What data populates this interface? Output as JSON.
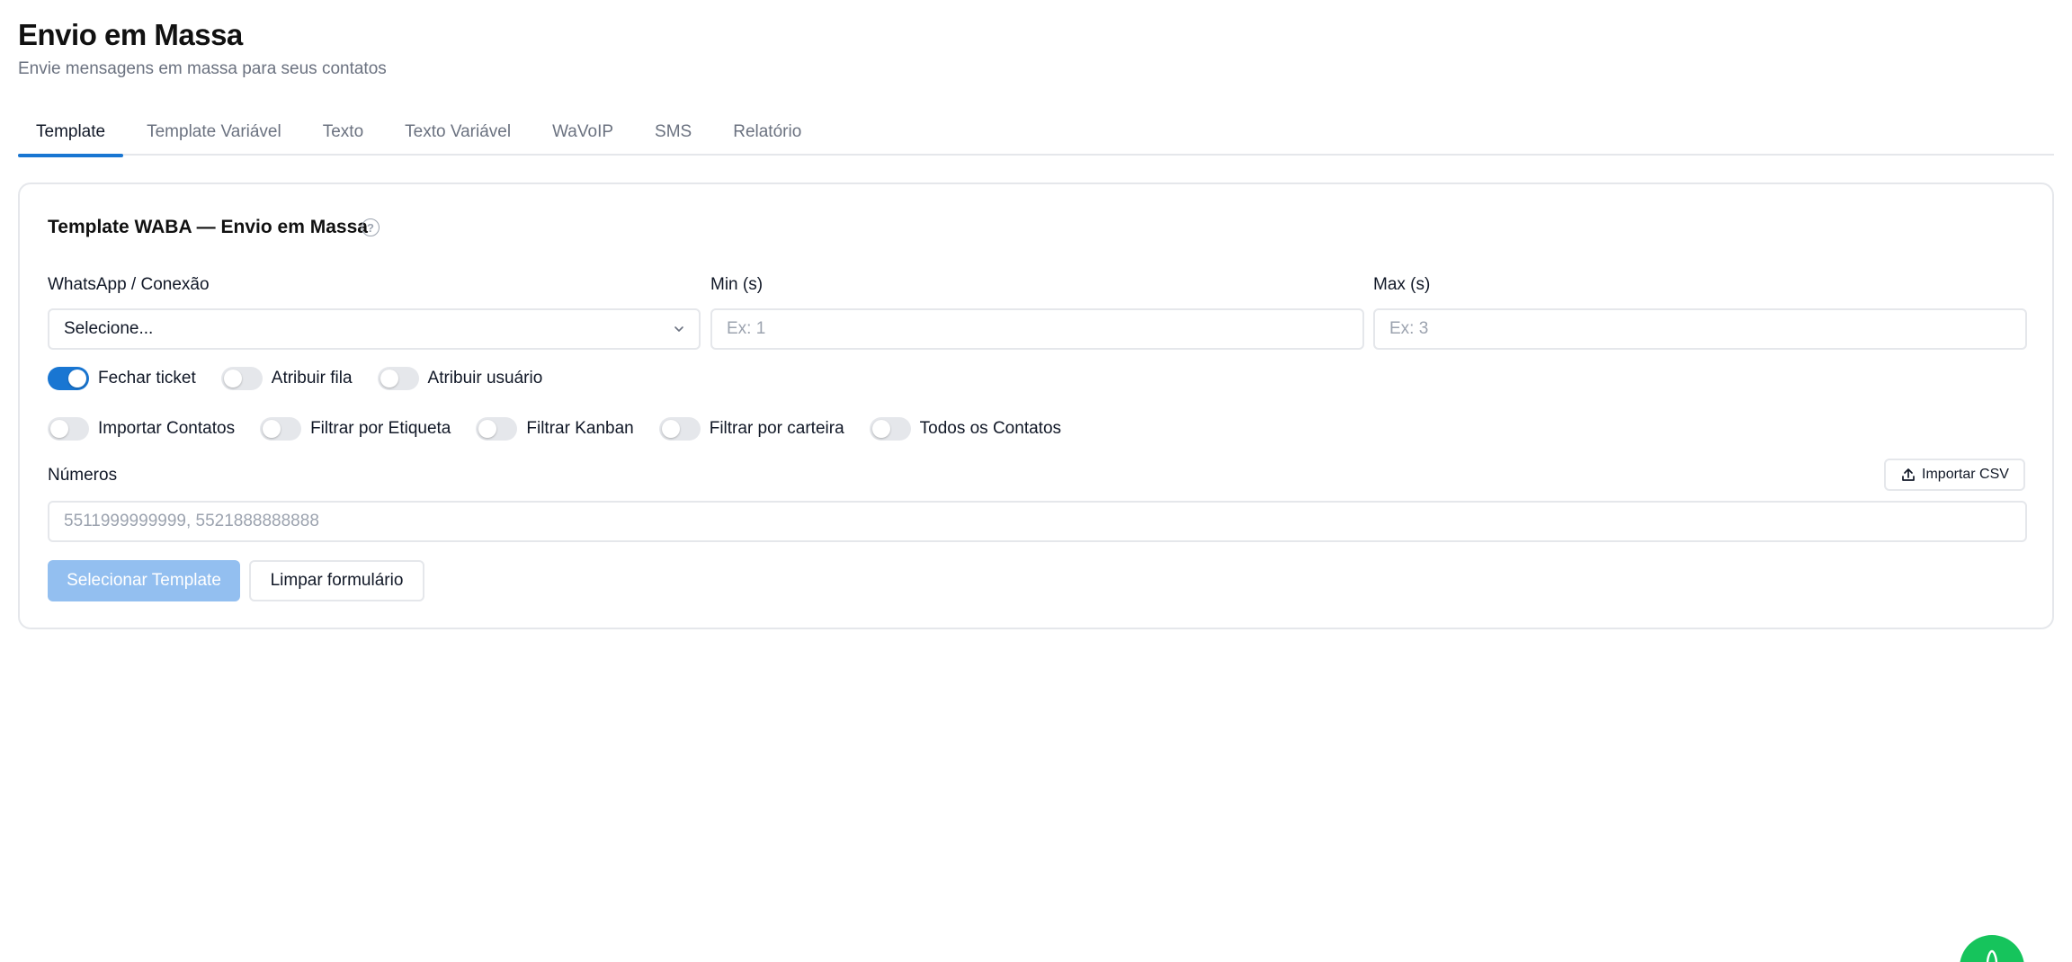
{
  "header": {
    "title": "Envio em Massa",
    "subtitle": "Envie mensagens em massa para seus contatos"
  },
  "tabs": [
    {
      "label": "Template",
      "active": true
    },
    {
      "label": "Template Variável",
      "active": false
    },
    {
      "label": "Texto",
      "active": false
    },
    {
      "label": "Texto Variável",
      "active": false
    },
    {
      "label": "WaVoIP",
      "active": false
    },
    {
      "label": "SMS",
      "active": false
    },
    {
      "label": "Relatório",
      "active": false
    }
  ],
  "card": {
    "title": "Template WABA — Envio em Massa",
    "help_icon": "help-circle-icon",
    "connection": {
      "label": "WhatsApp / Conexão",
      "value": "Selecione..."
    },
    "min": {
      "label": "Min (s)",
      "placeholder": "Ex: 1"
    },
    "max": {
      "label": "Max (s)",
      "placeholder": "Ex: 3"
    },
    "toggles_primary": [
      {
        "label": "Fechar ticket",
        "on": true
      },
      {
        "label": "Atribuir fila",
        "on": false
      },
      {
        "label": "Atribuir usuário",
        "on": false
      }
    ],
    "toggles_secondary": [
      {
        "label": "Importar Contatos",
        "on": false
      },
      {
        "label": "Filtrar por Etiqueta",
        "on": false
      },
      {
        "label": "Filtrar Kanban",
        "on": false
      },
      {
        "label": "Filtrar por carteira",
        "on": false
      },
      {
        "label": "Todos os Contatos",
        "on": false
      }
    ],
    "numbers": {
      "label": "Números",
      "placeholder": "5511999999999, 5521888888888",
      "import_csv_label": "Importar CSV",
      "import_icon": "upload-icon"
    },
    "buttons": {
      "select_template": "Selecionar Template",
      "clear_form": "Limpar formulário"
    }
  },
  "colors": {
    "accent": "#1976d2",
    "primary_disabled": "#93bff0",
    "fab": "#16c45c"
  }
}
